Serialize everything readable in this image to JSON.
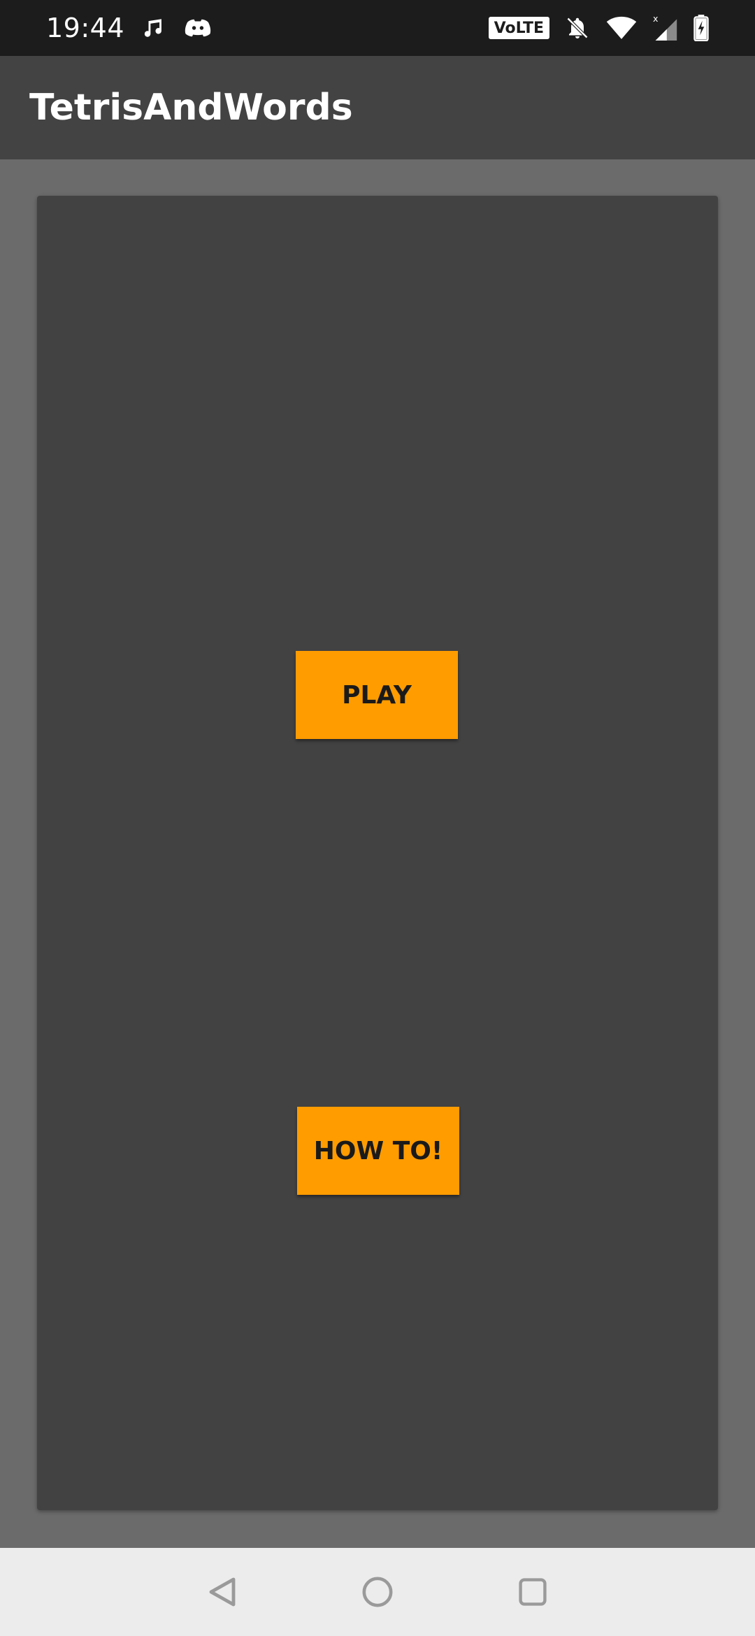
{
  "status_bar": {
    "time": "19:44",
    "network_badge": "VoLTE",
    "icons": [
      "music-note-icon",
      "discord-icon",
      "bell-off-icon",
      "wifi-icon",
      "cell-signal-icon",
      "battery-charging-icon"
    ]
  },
  "app_bar": {
    "title": "TetrisAndWords"
  },
  "main": {
    "play_label": "PLAY",
    "howto_label": "HOW TO!"
  },
  "nav_bar": {
    "icons": [
      "back-icon",
      "home-icon",
      "recents-icon"
    ]
  },
  "colors": {
    "accent": "#ff9c00",
    "app_bar": "#434343",
    "panel": "#424242",
    "background": "#6b6b6b",
    "status_bar": "#1c1c1c",
    "nav_bar": "#ececec"
  }
}
